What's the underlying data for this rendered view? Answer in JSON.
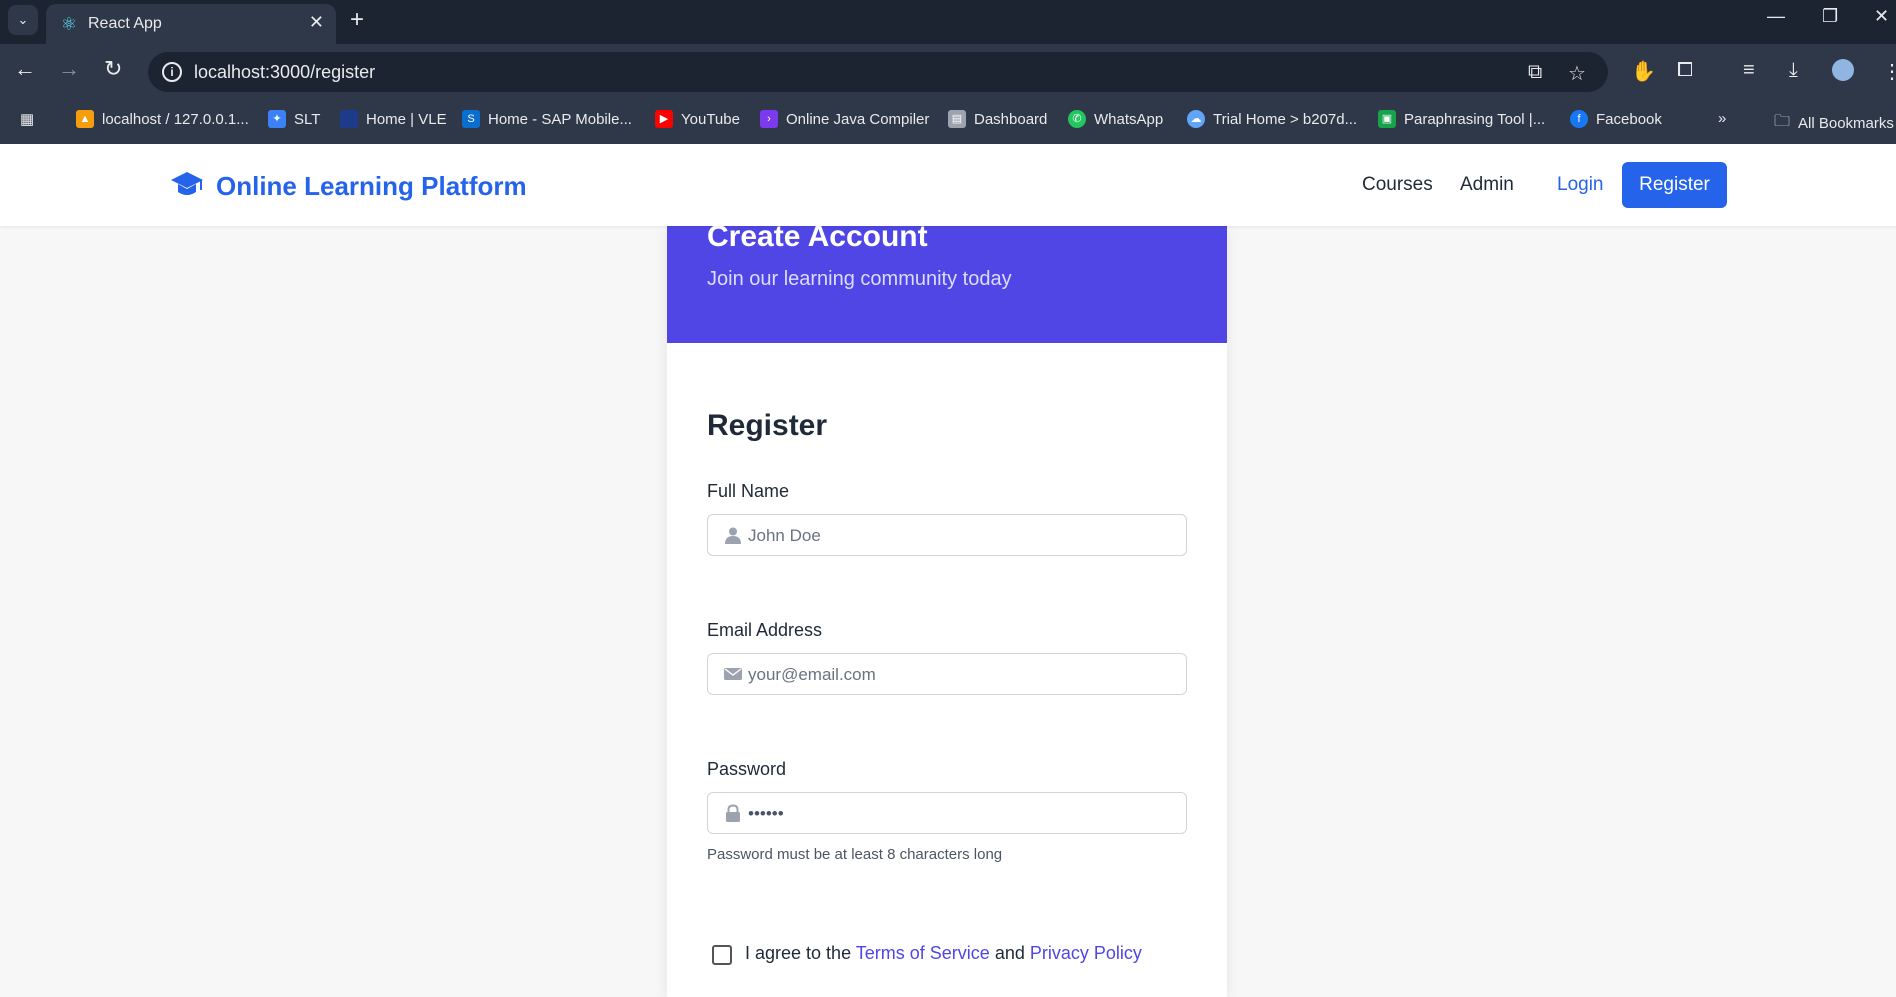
{
  "browser": {
    "tab_title": "React App",
    "url": "localhost:3000/register",
    "bookmarks": [
      "localhost / 127.0.0.1...",
      "SLT",
      "Home | VLE",
      "Home - SAP Mobile...",
      "YouTube",
      "Online Java Compiler",
      "Dashboard",
      "WhatsApp",
      "Trial Home > b207d...",
      "Paraphrasing Tool |...",
      "Facebook"
    ],
    "all_bookmarks": "All Bookmarks",
    "overflow": "»"
  },
  "header": {
    "brand": "Online Learning Platform",
    "nav": {
      "courses": "Courses",
      "admin": "Admin",
      "login": "Login",
      "register": "Register"
    }
  },
  "card": {
    "title": "Create Account",
    "subtitle": "Join our learning community today"
  },
  "form": {
    "title": "Register",
    "full_name": {
      "label": "Full Name",
      "placeholder": "John Doe"
    },
    "email": {
      "label": "Email Address",
      "placeholder": "your@email.com"
    },
    "password": {
      "label": "Password",
      "value_masked": "••••••",
      "hint": "Password must be at least 8 characters long"
    },
    "agree": {
      "prefix": "I agree to the",
      "terms": "Terms of Service",
      "and": "and",
      "privacy": "Privacy Policy"
    }
  },
  "colors": {
    "brand_blue": "#2563eb",
    "banner_indigo": "#4f46e5",
    "chrome_dark": "#1c2431"
  }
}
